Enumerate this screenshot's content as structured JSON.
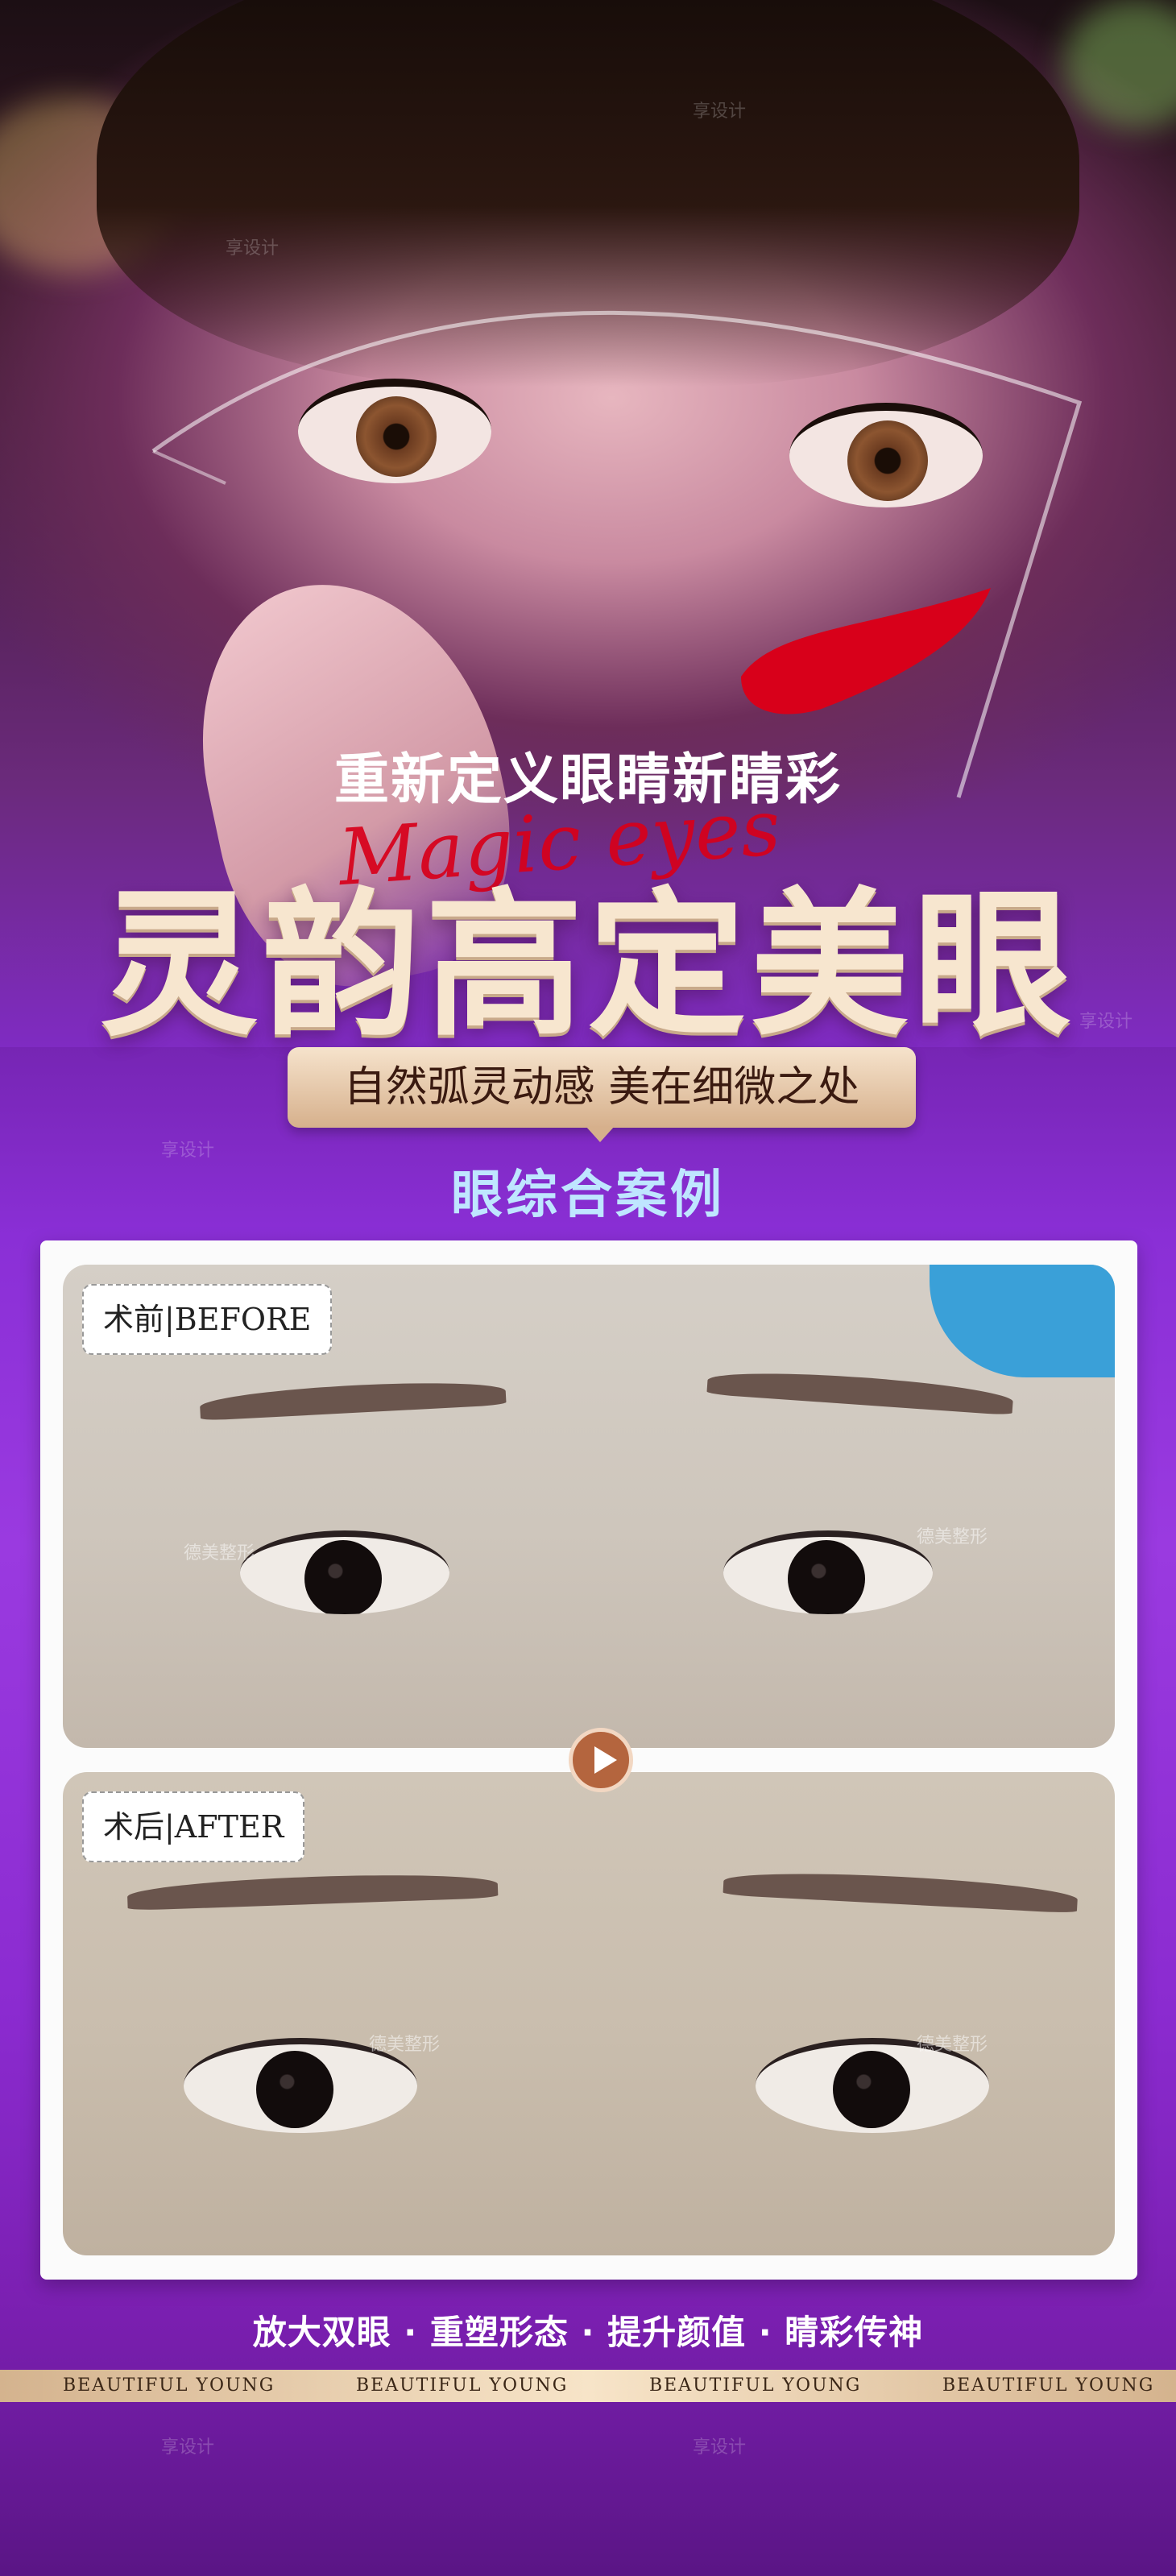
{
  "hero": {
    "subtitle": "重新定义眼睛新睛彩",
    "script_text": "Magic eyes",
    "title": "灵韵高定美眼"
  },
  "tagline": "自然弧灵动感 美在细微之处",
  "case_title": "眼综合案例",
  "before_after": {
    "before_label": "术前|BEFORE",
    "after_label": "术后|AFTER"
  },
  "features": "放大双眼 · 重塑形态 · 提升颜值 · 睛彩传神",
  "band_items": [
    "BEAUTIFUL  YOUNG",
    "BEAUTIFUL  YOUNG",
    "BEAUTIFUL  YOUNG",
    "BEAUTIFUL  YOUNG"
  ],
  "watermarks": {
    "site": "享设计",
    "clinic": "德美整形"
  },
  "colors": {
    "title_gold": "#f7e6cf",
    "pill_gold": "#d6b08c",
    "accent_red": "#d8001a",
    "case_title_blue": "#bfe6ff",
    "background_purple": "#8a2fd6"
  },
  "icons": {
    "play": "play-icon"
  }
}
